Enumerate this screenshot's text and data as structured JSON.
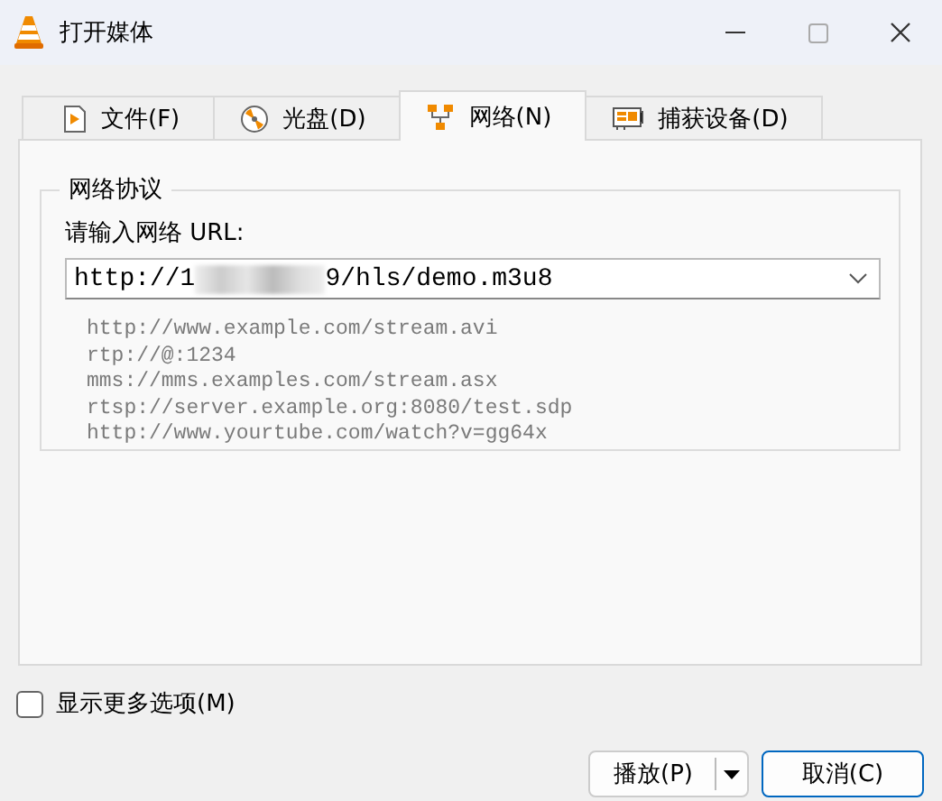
{
  "window": {
    "title": "打开媒体"
  },
  "tabs": [
    {
      "label": "文件(F)",
      "kind": "file",
      "selected": false
    },
    {
      "label": "光盘(D)",
      "kind": "disc",
      "selected": false
    },
    {
      "label": "网络(N)",
      "kind": "network",
      "selected": true
    },
    {
      "label": "捕获设备(D)",
      "kind": "capture",
      "selected": false
    }
  ],
  "group": {
    "title": "网络协议",
    "prompt": "请输入网络 URL:",
    "url_field": {
      "value_start": "http://1",
      "redacted": true,
      "value_end": "9/hls/demo.m3u8"
    },
    "examples": [
      "http://www.example.com/stream.avi",
      "rtp://@:1234",
      "mms://mms.examples.com/stream.asx",
      "rtsp://server.example.org:8080/test.sdp",
      "http://www.yourtube.com/watch?v=gg64x"
    ]
  },
  "more_options": {
    "label": "显示更多选项(M)",
    "checked": false
  },
  "buttons": [
    {
      "label": "播放(P)",
      "kind": "split"
    },
    {
      "label": "取消(C)",
      "kind": "default"
    }
  ]
}
